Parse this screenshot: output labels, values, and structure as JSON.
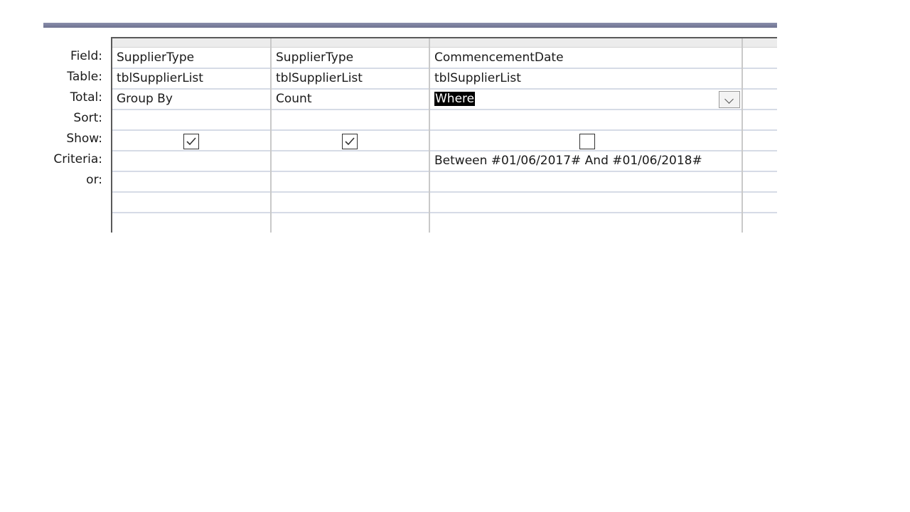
{
  "row_labels": [
    "Field:",
    "Table:",
    "Total:",
    "Sort:",
    "Show:",
    "Criteria:",
    "or:"
  ],
  "columns": [
    {
      "field": "SupplierType",
      "table": "tblSupplierList",
      "total": "Group By",
      "sort": "",
      "show": true,
      "criteria": "",
      "or": ""
    },
    {
      "field": "SupplierType",
      "table": "tblSupplierList",
      "total": "Count",
      "sort": "",
      "show": true,
      "criteria": "",
      "or": ""
    },
    {
      "field": "CommencementDate",
      "table": "tblSupplierList",
      "total": "Where",
      "sort": "",
      "show": false,
      "criteria": "Between #01/06/2017# And #01/06/2018#",
      "or": ""
    }
  ],
  "selected_cell": "columns.2.total",
  "icons": {
    "dropdown": "chevron-down-icon",
    "checkbox_checked": "checkmark-icon"
  }
}
